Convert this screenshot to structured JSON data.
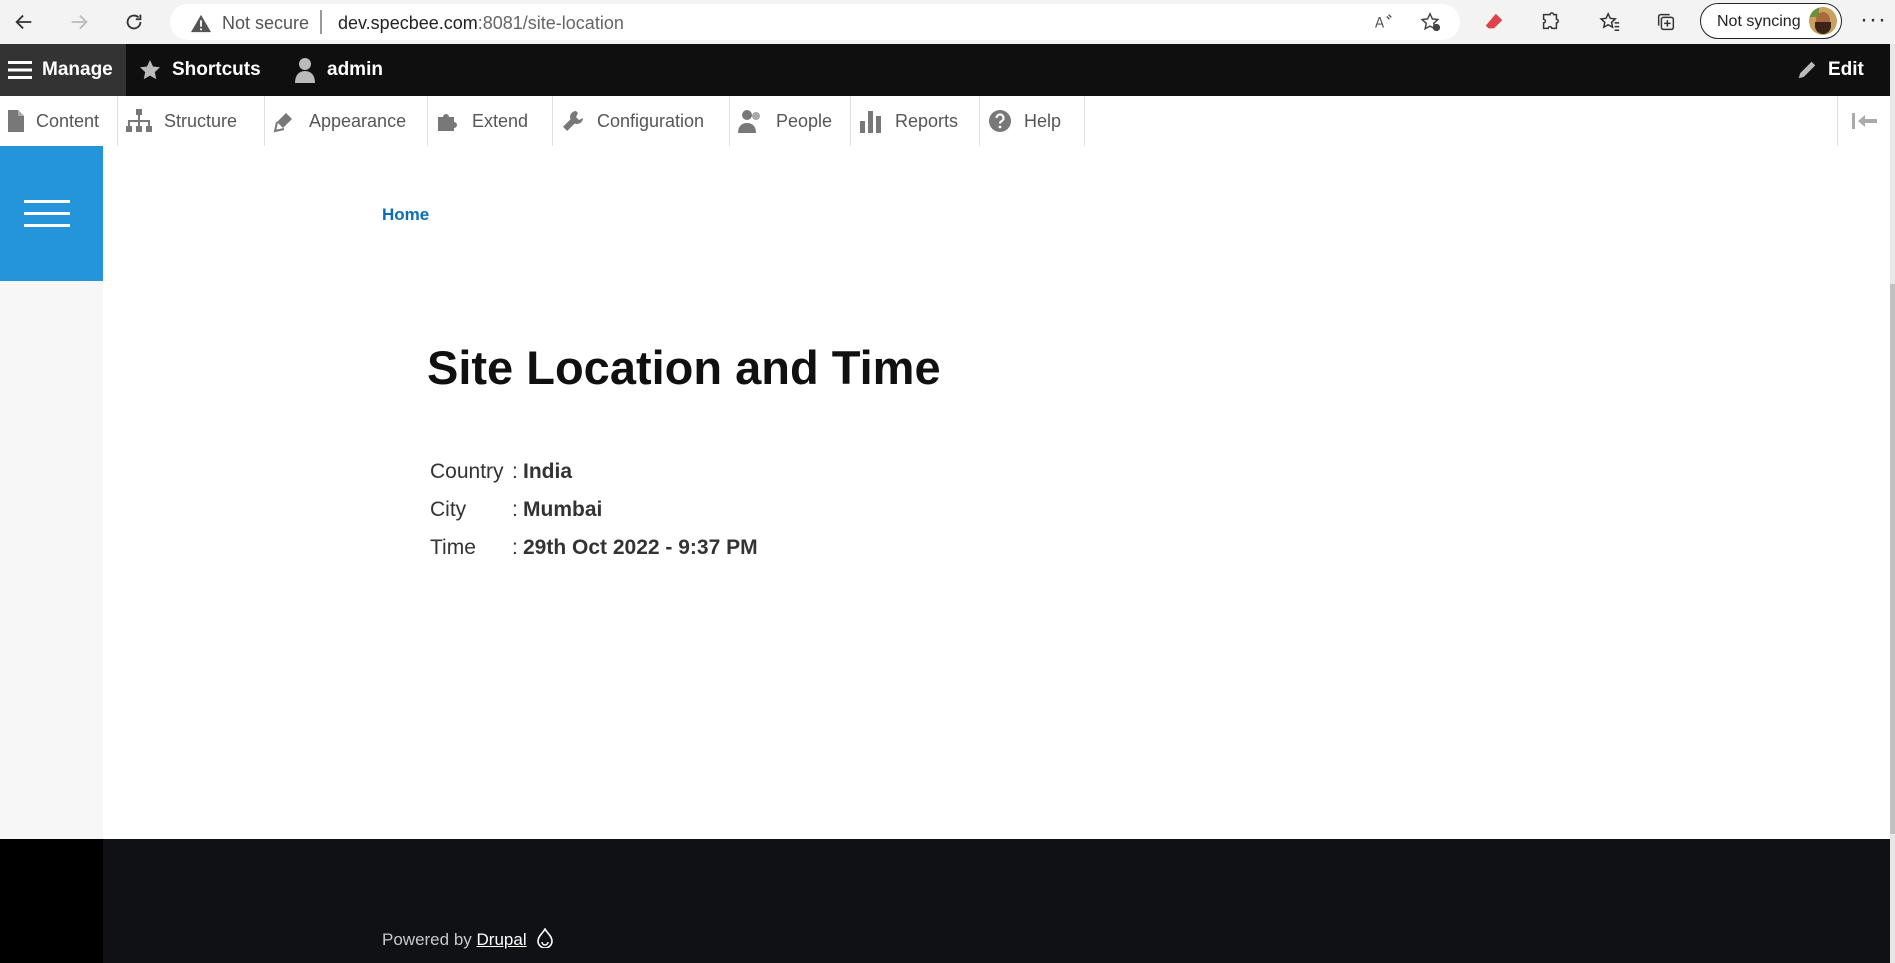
{
  "browser": {
    "security": "Not secure",
    "url_host": "dev.specbee.com",
    "url_rest": ":8081/site-location",
    "sync_label": "Not syncing"
  },
  "toolbar": {
    "manage": "Manage",
    "shortcuts": "Shortcuts",
    "user": "admin",
    "edit": "Edit"
  },
  "tray": {
    "items": [
      {
        "label": "Content"
      },
      {
        "label": "Structure"
      },
      {
        "label": "Appearance"
      },
      {
        "label": "Extend"
      },
      {
        "label": "Configuration"
      },
      {
        "label": "People"
      },
      {
        "label": "Reports"
      },
      {
        "label": "Help"
      }
    ]
  },
  "page": {
    "breadcrumb": "Home",
    "title": "Site Location and Time",
    "rows": [
      {
        "label": "Country",
        "value": "India"
      },
      {
        "label": "City",
        "value": "Mumbai"
      },
      {
        "label": "Time",
        "value": "29th Oct 2022 - 9:37 PM"
      }
    ]
  },
  "footer": {
    "powered_by": "Powered by",
    "drupal": "Drupal"
  }
}
